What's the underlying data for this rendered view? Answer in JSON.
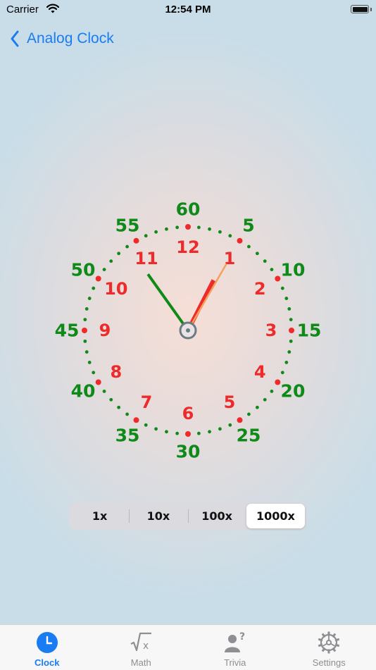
{
  "status_bar": {
    "carrier": "Carrier",
    "time": "12:54 PM"
  },
  "nav": {
    "back_label": "Analog Clock"
  },
  "clock": {
    "minute_labels": [
      "60",
      "5",
      "10",
      "15",
      "20",
      "25",
      "30",
      "35",
      "40",
      "45",
      "50",
      "55"
    ],
    "hour_labels": [
      "12",
      "1",
      "2",
      "3",
      "4",
      "5",
      "6",
      "7",
      "8",
      "9",
      "10",
      "11"
    ],
    "hour": 12,
    "minute": 54,
    "second": 5
  },
  "speed": {
    "options": [
      "1x",
      "10x",
      "100x",
      "1000x"
    ],
    "selected": "1000x"
  },
  "tabs": [
    {
      "label": "Clock",
      "icon": "clock-icon",
      "active": true
    },
    {
      "label": "Math",
      "icon": "square-root-icon",
      "active": false
    },
    {
      "label": "Trivia",
      "icon": "person-question-icon",
      "active": false
    },
    {
      "label": "Settings",
      "icon": "gear-icon",
      "active": false
    }
  ],
  "colors": {
    "accent": "#1a7cf2",
    "minute_numbers": "#0f8a19",
    "hour_numbers": "#ee2b2b",
    "second_hand": "#f5a05c"
  }
}
